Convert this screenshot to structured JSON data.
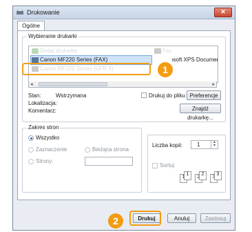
{
  "window": {
    "title": "Drukowanie",
    "close_label": "✕"
  },
  "tabs": [
    {
      "label": "Ogólne"
    }
  ],
  "printer_group": {
    "label": "Wybieranie drukarki",
    "printers": [
      {
        "name": "Dodaj drukarkę"
      },
      {
        "name": "Canon MF220 Series (FAX)"
      },
      {
        "name": "Canon MF220 Series (UFR II)"
      },
      {
        "name": "Fax"
      },
      {
        "name": "Microsoft XPS Document Writer"
      }
    ],
    "status_label": "Stan:",
    "status_value": "Wstrzymana",
    "location_label": "Lokalizacja:",
    "comment_label": "Komentarz:",
    "print_to_file_label": "Drukuj do pliku",
    "preferences_label": "Preferencje",
    "find_printer_label": "Znajdź drukarkę..."
  },
  "range_group": {
    "label": "Zakres stron",
    "all_label": "Wszystko",
    "selection_label": "Zaznaczenie",
    "current_page_label": "Bieżąca strona",
    "pages_label": "Strony:"
  },
  "copies": {
    "count_label": "Liczba kopii:",
    "count_value": "1",
    "collate_label": "Sortuj",
    "collate_glyphs": [
      "1",
      "1",
      "2",
      "2",
      "3",
      "3"
    ]
  },
  "buttons": {
    "print": "Drukuj",
    "cancel": "Anuluj",
    "apply": "Zastosuj"
  },
  "callouts": {
    "first": "1",
    "second": "2"
  },
  "colors": {
    "accent": "#f39c12",
    "selection": "#cfe3fb"
  }
}
